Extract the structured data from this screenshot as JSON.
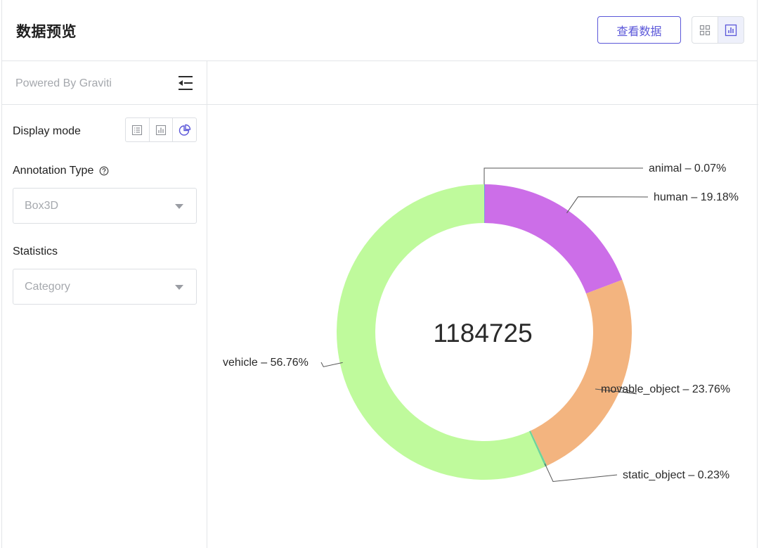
{
  "header": {
    "title": "数据预览",
    "view_data_label": "查看数据",
    "layout_toggle": {
      "options": [
        "grid-icon",
        "bar-chart-icon"
      ],
      "active": "bar-chart-icon"
    }
  },
  "sidebar": {
    "powered_by": "Powered By Graviti",
    "display_mode": {
      "label": "Display mode",
      "options": [
        "list-icon",
        "bar-chart-icon",
        "pie-chart-icon"
      ],
      "active": "pie-chart-icon"
    },
    "annotation_type": {
      "label": "Annotation Type",
      "value": "Box3D"
    },
    "statistics": {
      "label": "Statistics",
      "value": "Category"
    }
  },
  "colors": {
    "accent": "#5b57d9",
    "animal": "#4a90e2",
    "human": "#cc6ee8",
    "movable_object": "#f3b47f",
    "static_object": "#6dd49a",
    "vehicle": "#bffa9c"
  },
  "chart_data": {
    "type": "pie",
    "variant": "donut",
    "center_label": "1184725",
    "slices": [
      {
        "name": "animal",
        "percent": 0.07,
        "label": "animal – 0.07%"
      },
      {
        "name": "human",
        "percent": 19.18,
        "label": "human – 19.18%"
      },
      {
        "name": "movable_object",
        "percent": 23.76,
        "label": "movable_object – 23.76%"
      },
      {
        "name": "static_object",
        "percent": 0.23,
        "label": "static_object – 0.23%"
      },
      {
        "name": "vehicle",
        "percent": 56.76,
        "label": "vehicle – 56.76%"
      }
    ]
  }
}
